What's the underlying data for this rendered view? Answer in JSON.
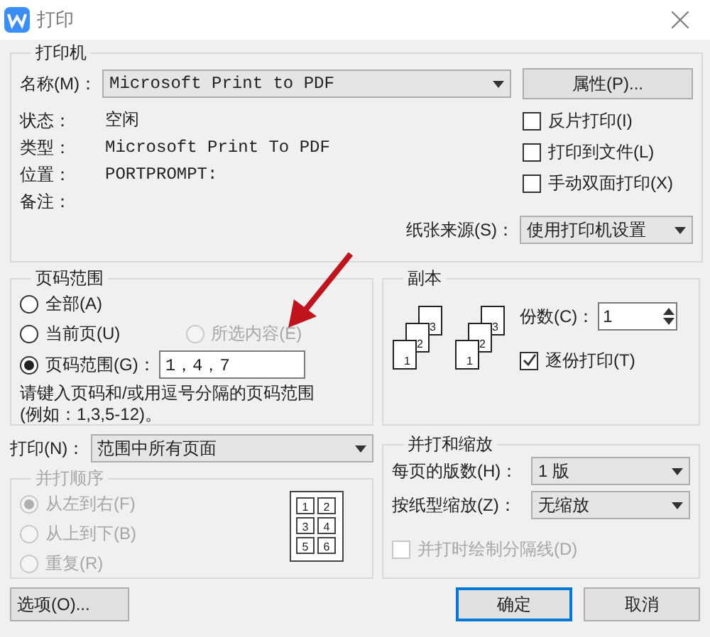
{
  "window": {
    "title": "打印"
  },
  "printer": {
    "title": "打印机",
    "name_label": "名称(M)：",
    "name_value": "Microsoft Print to PDF",
    "properties_button": "属性(P)...",
    "info": [
      {
        "label": "状态：",
        "value": "空闲"
      },
      {
        "label": "类型：",
        "value": "Microsoft Print To PDF"
      },
      {
        "label": "位置：",
        "value": "PORTPROMPT:"
      },
      {
        "label": "备注："
      }
    ],
    "checkboxes": [
      {
        "label": "反片打印(I)",
        "checked": false
      },
      {
        "label": "打印到文件(L)",
        "checked": false
      },
      {
        "label": "手动双面打印(X)",
        "checked": false
      }
    ],
    "paper_source_label": "纸张来源(S)：",
    "paper_source_value": "使用打印机设置"
  },
  "page_range": {
    "title": "页码范围",
    "options": [
      {
        "label": "全部(A)",
        "selected": false,
        "disabled": false
      },
      {
        "label": "当前页(U)",
        "selected": false,
        "disabled": false
      },
      {
        "label": "所选内容(E)",
        "selected": false,
        "disabled": true
      },
      {
        "label": "页码范围(G)：",
        "selected": true,
        "disabled": false
      }
    ],
    "range_value": "1，4，7",
    "hint": "请键入页码和/或用逗号分隔的页码范围(例如：1,3,5-12)。"
  },
  "copies": {
    "title": "副本",
    "stacks": [
      {
        "labels": [
          "1",
          "2",
          "3"
        ]
      },
      {
        "labels": [
          "1",
          "2",
          "3"
        ]
      }
    ],
    "count_label": "份数(C)：",
    "count_value": "1",
    "collate": {
      "label": "逐份打印(T)",
      "checked": true
    }
  },
  "print_what": {
    "label": "打印(N)：",
    "value": "范围中所有页面"
  },
  "order": {
    "title": "并打顺序",
    "disabled": true,
    "options": [
      {
        "label": "从左到右(F)",
        "selected": true
      },
      {
        "label": "从上到下(B)",
        "selected": false
      },
      {
        "label": "重复(R)",
        "selected": false
      }
    ],
    "preview_labels": [
      "1",
      "2",
      "3",
      "4",
      "5",
      "6"
    ]
  },
  "scaling": {
    "title": "并打和缩放",
    "pages_label": "每页的版数(H)：",
    "pages_value": "1 版",
    "scale_label": "按纸型缩放(Z)：",
    "scale_value": "无缩放",
    "draw_lines": {
      "label": "并打时绘制分隔线(D)",
      "checked": false,
      "disabled": true
    }
  },
  "buttons": {
    "options": "选项(O)...",
    "ok": "确定",
    "cancel": "取消"
  }
}
